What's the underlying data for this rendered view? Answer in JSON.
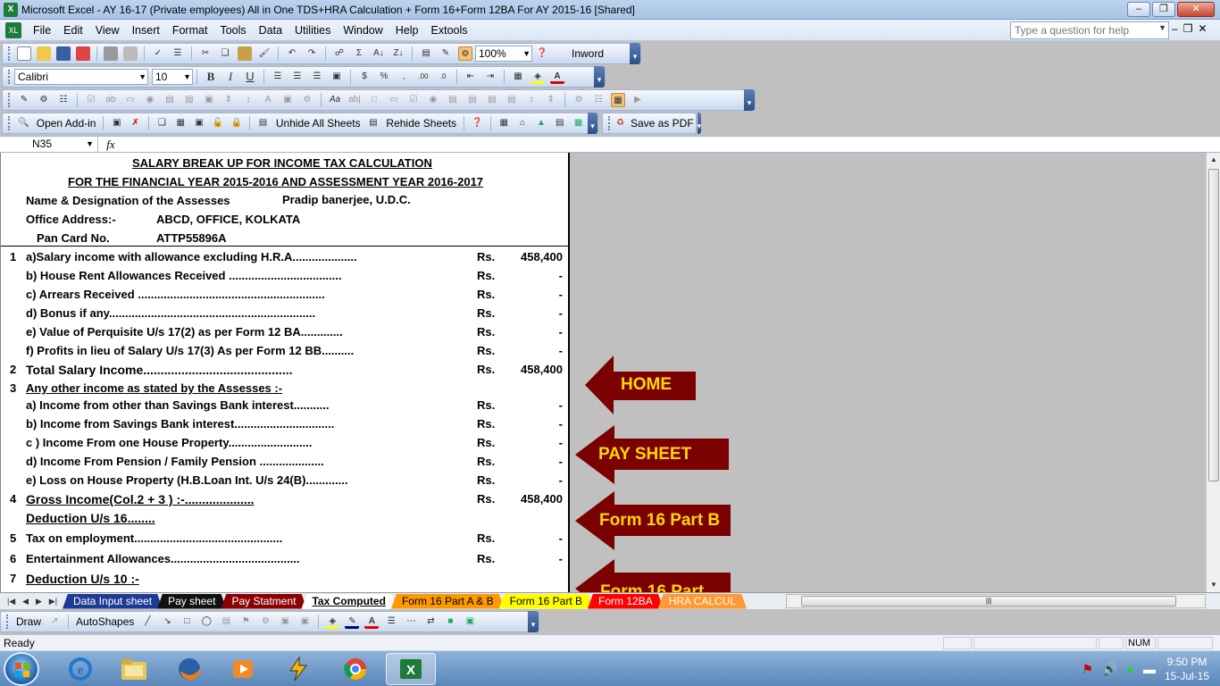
{
  "window": {
    "title": "Microsoft Excel - AY 16-17 (Private employees)  All in One TDS+HRA Calculation + Form 16+Form 12BA For AY 2015-16  [Shared]"
  },
  "menu": [
    "File",
    "Edit",
    "View",
    "Insert",
    "Format",
    "Tools",
    "Data",
    "Utilities",
    "Window",
    "Help",
    "Extools"
  ],
  "help_box": {
    "placeholder": "Type a question for help"
  },
  "toolbar_standard": {
    "zoom": "100%",
    "inword": "Inword"
  },
  "toolbar_format": {
    "font": "Calibri",
    "size": "10"
  },
  "toolbar_addin": {
    "open_addin": "Open Add-in",
    "unhide": "Unhide All Sheets",
    "rehide": "Rehide Sheets",
    "save_pdf": "Save as PDF"
  },
  "formula_bar": {
    "cell_ref": "N35",
    "fx": "fx",
    "content": ""
  },
  "sheet": {
    "title1": "SALARY BREAK UP FOR INCOME TAX CALCULATION",
    "title2": "FOR THE FINANCIAL YEAR 2015-2016 AND ASSESSMENT YEAR 2016-2017",
    "name_label": "Name & Designation of the Assesses",
    "name_value": "Pradip banerjee, U.D.C.",
    "office_label": "Office Address:-",
    "office_value": "ABCD, OFFICE, KOLKATA",
    "pan_label": "Pan Card No.",
    "pan_value": "ATTP55896A",
    "rows": [
      {
        "num": "1",
        "label": "a)Salary income with allowance excluding H.R.A....................",
        "rs": "Rs.",
        "value": "458,400"
      },
      {
        "num": "",
        "label": "b) House Rent Allowances Received ...................................",
        "rs": "Rs.",
        "value": "-"
      },
      {
        "num": "",
        "label": "c) Arrears Received ..........................................................",
        "rs": "Rs.",
        "value": "-"
      },
      {
        "num": "",
        "label": "d) Bonus if any................................................................",
        "rs": "Rs.",
        "value": "-"
      },
      {
        "num": "",
        "label": "e) Value of Perquisite U/s 17(2) as per Form 12 BA.............",
        "rs": "Rs.",
        "value": "-"
      },
      {
        "num": "",
        "label": "f) Profits in lieu of Salary U/s 17(3) As per Form 12 BB..........",
        "rs": "Rs.",
        "value": "-"
      },
      {
        "num": "2",
        "label": "Total Salary Income...........................................",
        "rs": "Rs.",
        "value": "458,400"
      },
      {
        "num": "3",
        "label": "Any other income as stated by the Assesses :-",
        "rs": "",
        "value": ""
      },
      {
        "num": "",
        "label": "a) Income from other than Savings Bank interest...........",
        "rs": "Rs.",
        "value": "-"
      },
      {
        "num": "",
        "label": "b) Income  from Savings Bank interest...............................",
        "rs": "Rs.",
        "value": "-"
      },
      {
        "num": "",
        "label": "c ) Income From one House Property..........................",
        "rs": "Rs.",
        "value": "-"
      },
      {
        "num": "",
        "label": "d) Income From Pension / Family Pension ....................",
        "rs": "Rs.",
        "value": "-"
      },
      {
        "num": "",
        "label": "e) Loss on House Property (H.B.Loan Int. U/s 24(B).............",
        "rs": "Rs.",
        "value": "-"
      },
      {
        "num": "4",
        "label": "Gross Income(Col.2 + 3 ) :-....................",
        "rs": "Rs.",
        "value": "458,400"
      },
      {
        "num": "",
        "label": "Deduction U/s 16........",
        "rs": "",
        "value": ""
      },
      {
        "num": "5",
        "label": "Tax on employment..............................................",
        "rs": "Rs.",
        "value": "-"
      },
      {
        "num": "6",
        "label": "Entertainment Allowances........................................",
        "rs": "Rs.",
        "value": "-"
      },
      {
        "num": "7",
        "label": "Deduction U/s 10 :-",
        "rs": "",
        "value": ""
      }
    ]
  },
  "nav_buttons": [
    "HOME",
    "PAY SHEET",
    "Form 16 Part B",
    "Form 16 Part"
  ],
  "tabs": [
    {
      "label": "Data Input sheet",
      "bg": "#1f3a93",
      "fg": "#ffffff"
    },
    {
      "label": "Pay sheet",
      "bg": "#111111",
      "fg": "#ffffff"
    },
    {
      "label": "Pay Statment",
      "bg": "#8b0000",
      "fg": "#ffffff"
    },
    {
      "label": "Tax Computed",
      "bg": "#ffffff",
      "fg": "#000000"
    },
    {
      "label": "Form 16 Part A & B",
      "bg": "#ff9900",
      "fg": "#000000"
    },
    {
      "label": "Form 16 Part B",
      "bg": "#ffff00",
      "fg": "#000000"
    },
    {
      "label": "Form 12BA",
      "bg": "#ff0000",
      "fg": "#ffffff"
    },
    {
      "label": "HRA CALCUL",
      "bg": "#ff9933",
      "fg": "#ffffff"
    }
  ],
  "draw_toolbar": {
    "draw": "Draw",
    "autoshapes": "AutoShapes"
  },
  "status": {
    "ready": "Ready",
    "num": "NUM"
  },
  "clock": {
    "time": "9:50 PM",
    "date": "15-Jul-15"
  },
  "colors": {
    "arrow_fill": "#7b0000",
    "arrow_text": "#ffd700",
    "excel_green": "#1d7a3a"
  }
}
